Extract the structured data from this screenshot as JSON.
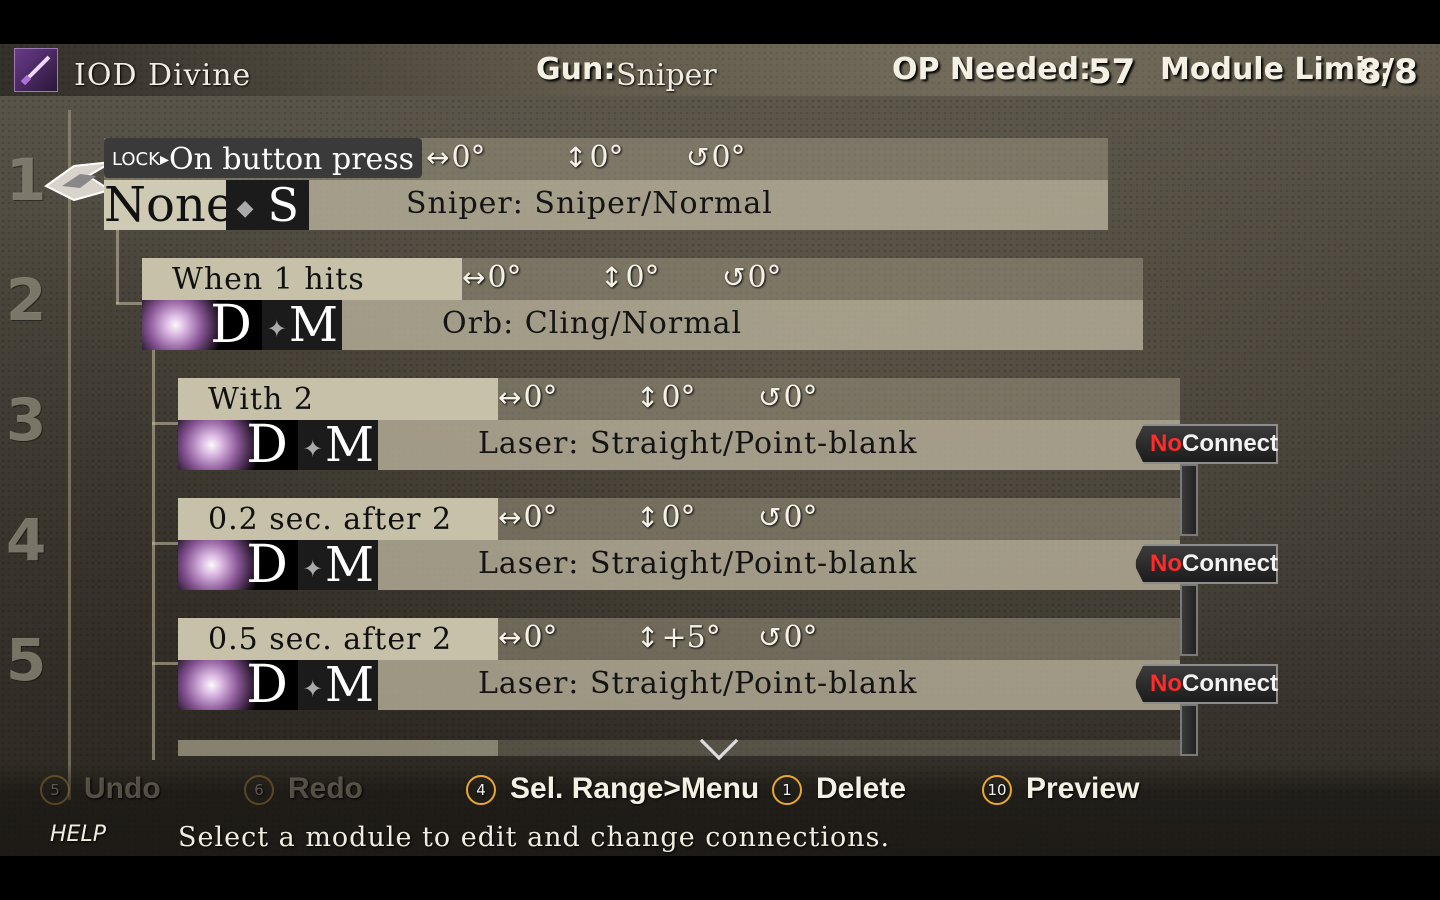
{
  "header": {
    "weapon_name": "IOD Divine",
    "gun_label": "Gun:",
    "gun_value": "Sniper",
    "op_label": "OP Needed:",
    "op_value": "57",
    "module_limit_label": "Module Limit:",
    "module_limit_value": "8/8"
  },
  "steps": [
    "1",
    "2",
    "3",
    "4",
    "5"
  ],
  "modules": [
    {
      "lock": "LOCK",
      "trigger": "On button press",
      "h_angle": "0°",
      "v_angle": "0°",
      "r_angle": "0°",
      "element": "None",
      "size": "S",
      "bullet": "Sniper: Sniper/Normal"
    },
    {
      "trigger": "When 1 hits",
      "h_angle": "0°",
      "v_angle": "0°",
      "r_angle": "0°",
      "element": "D",
      "size": "M",
      "bullet": "Orb: Cling/Normal"
    },
    {
      "trigger": "With 2",
      "h_angle": "0°",
      "v_angle": "0°",
      "r_angle": "0°",
      "element": "D",
      "size": "M",
      "bullet": "Laser: Straight/Point-blank",
      "connection_no": "No",
      "connection_text": "Connection"
    },
    {
      "trigger": "0.2 sec. after 2",
      "h_angle": "0°",
      "v_angle": "0°",
      "r_angle": "0°",
      "element": "D",
      "size": "M",
      "bullet": "Laser: Straight/Point-blank",
      "connection_no": "No",
      "connection_text": "Connection"
    },
    {
      "trigger": "0.5 sec. after 2",
      "h_angle": "0°",
      "v_angle": "+5°",
      "r_angle": "0°",
      "element": "D",
      "size": "M",
      "bullet": "Laser: Straight/Point-blank",
      "connection_no": "No",
      "connection_text": "Connection"
    }
  ],
  "footer": {
    "controls": [
      {
        "button": "5",
        "label": "Undo",
        "state": "disabled"
      },
      {
        "button": "6",
        "label": "Redo",
        "state": "disabled"
      },
      {
        "button": "4",
        "label": "Sel. Range>Menu",
        "state": "enabled"
      },
      {
        "button": "1",
        "label": "Delete",
        "state": "enabled"
      },
      {
        "button": "10",
        "label": "Preview",
        "state": "enabled"
      }
    ],
    "help_label": "HELP",
    "help_text": "Select a module to edit and change connections."
  },
  "icons": {
    "horizontal": "horizontal-arrow-icon",
    "vertical": "vertical-arrow-icon",
    "rotation": "rotation-icon",
    "scroll": "chevron-down-icon"
  },
  "colors": {
    "no_connection_red": "#ff2a2a",
    "button_ring": "#e9a832",
    "trigger_bg": "#c6c1a8"
  }
}
